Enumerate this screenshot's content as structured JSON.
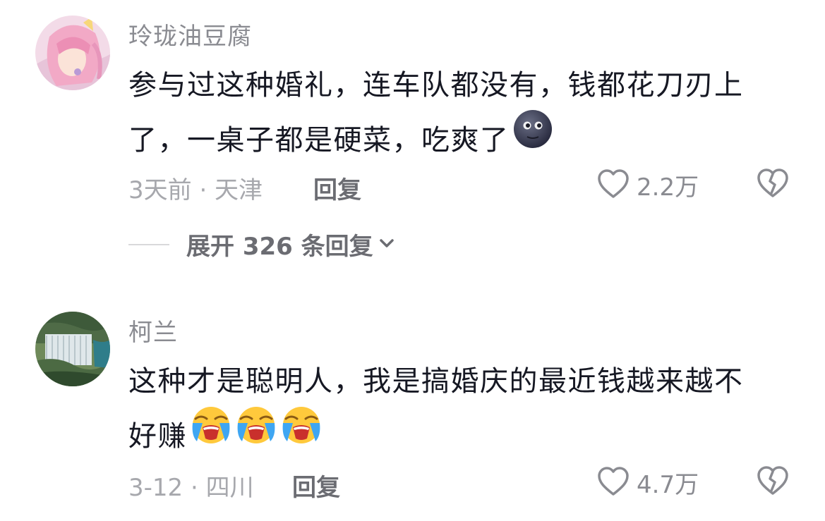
{
  "comments": [
    {
      "username": "玲珑油豆腐",
      "text_line1": "参与过这种婚礼，连车队都没有，钱都花刀刃上",
      "text_line2": "了，一桌子都是硬菜，吃爽了",
      "emojis": [
        "new-moon-face-emoji"
      ],
      "meta": "3天前 · 天津",
      "reply_label": "回复",
      "likes": "2.2万",
      "expand_label": "展开 326 条回复"
    },
    {
      "username": "柯兰",
      "text_line1": "这种才是聪明人，我是搞婚庆的最近钱越来越不",
      "text_line2": "好赚",
      "emojis": [
        "loudly-crying-face-emoji",
        "loudly-crying-face-emoji",
        "loudly-crying-face-emoji"
      ],
      "meta": "3-12 · 四川",
      "reply_label": "回复",
      "likes": "4.7万"
    }
  ],
  "colors": {
    "primary_text": "#161823",
    "secondary_text": "#8a8b91",
    "meta_text": "#a7a8ad",
    "action_text": "#6b6c72"
  },
  "icons": [
    "heart-outline-icon",
    "broken-heart-icon",
    "chevron-down-icon"
  ]
}
